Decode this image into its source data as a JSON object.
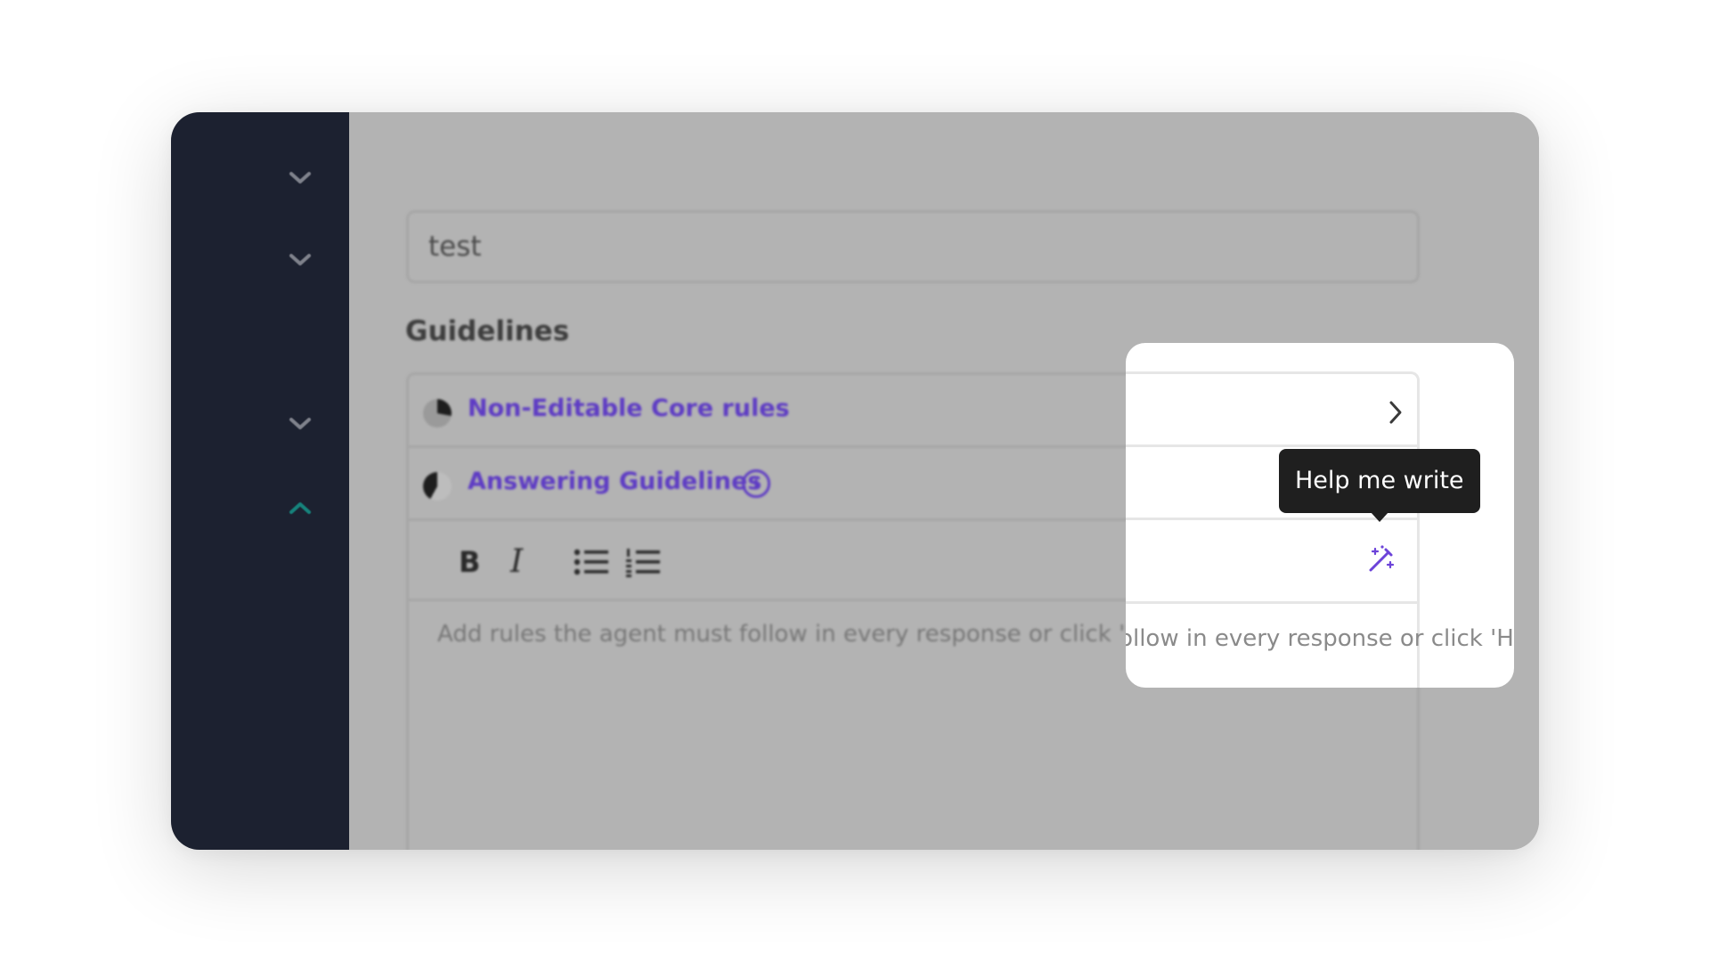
{
  "sidebar": {
    "chevrons": [
      "chevron-down-icon",
      "chevron-down-icon",
      "chevron-down-icon",
      "chevron-up-icon"
    ],
    "accent_color": "#168d84"
  },
  "form": {
    "name_value": "test",
    "guidelines_heading": "Guidelines",
    "rows": [
      {
        "label": "Non-Editable Core rules",
        "icon": "pie-icon",
        "action_icon": "chevron-right-icon"
      },
      {
        "label": "Answering Guidelines",
        "icon": "pie-icon",
        "info_icon": "info-icon"
      }
    ],
    "toolbar": {
      "bold_label": "B",
      "italic_label": "I",
      "bullets_icon": "bulleted-list-icon",
      "numbered_icon": "numbered-list-icon",
      "assist_icon": "magic-wand-icon"
    },
    "editor_placeholder": "Add rules the agent must follow in every response or click 'Help me write' to au",
    "info_symbol": "i"
  },
  "tooltip": {
    "text": "Help me write"
  },
  "colors": {
    "label_purple": "#5e3cc4",
    "wand_purple": "#6c43d9",
    "sidebar_bg": "#1c2130",
    "overlay_gray": "#b3b3b3"
  }
}
